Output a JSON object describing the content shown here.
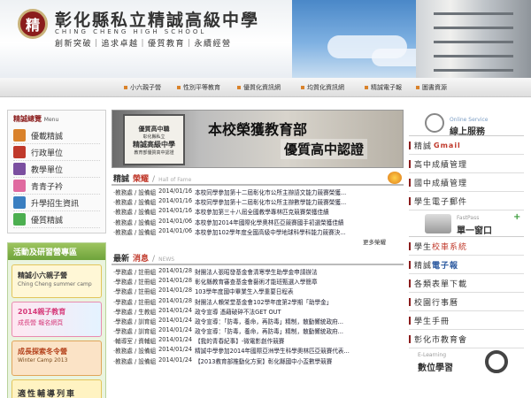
{
  "header": {
    "logo_char": "精",
    "school_name": "彰化縣私立精誠高級中學",
    "school_en": "CHING CHENG HIGH SCHOOL",
    "motto": "創新突破｜追求卓越｜優質教育｜永續經營"
  },
  "nav": [
    {
      "label": "小六親子營"
    },
    {
      "label": "性別平等教育"
    },
    {
      "label": "優質化資訊網"
    },
    {
      "label": "均質化資訊網"
    },
    {
      "label": "精誠電子報"
    },
    {
      "label": "圖書資源"
    }
  ],
  "sidebar": {
    "title": "精誠總覽",
    "title_en": "Menu",
    "items": [
      {
        "label": "優載精誠",
        "color": "#d9822b"
      },
      {
        "label": "行政單位",
        "color": "#c0392b"
      },
      {
        "label": "教學單位",
        "color": "#7b4fa0"
      },
      {
        "label": "青青子衿",
        "color": "#e06aa0"
      },
      {
        "label": "升學招生資訊",
        "color": "#3a7fc1"
      },
      {
        "label": "優質精誠",
        "color": "#4caf50"
      }
    ]
  },
  "promo": {
    "title": "活動及研習營專區",
    "cards": [
      {
        "title": "精誠小六親子營",
        "sub": "Ching Cheng summer camp"
      },
      {
        "title": "2014親子教育",
        "sub": "成長營 報名網頁"
      },
      {
        "title": "成長探索冬令營",
        "sub": "Winter Camp 2013"
      },
      {
        "title": "適性輔導列車",
        "sub": ""
      }
    ]
  },
  "banner": {
    "badge_line1": "優質高中職",
    "badge_line2": "彰化縣私立",
    "badge_line3": "精誠高級中學",
    "badge_line4": "教育部優質高中認證",
    "headline1": "本校榮獲教育部",
    "headline2": "優質高中認證"
  },
  "honor": {
    "title": "精誠",
    "title_red": "榮耀",
    "title_sep": "/",
    "title_en": "Hall of Fame",
    "rows": [
      {
        "dept": "‧教務處 / 設備組",
        "date": "2014/01/16",
        "text": "本校同學參加第十二屆彰化市公所主辦語文能力競賽榮獲..."
      },
      {
        "dept": "‧教務處 / 設備組",
        "date": "2014/01/16",
        "text": "本校同學參加第十二屆彰化市公所主辦數學能力競賽榮獲..."
      },
      {
        "dept": "‧教務處 / 設備組",
        "date": "2014/01/16",
        "text": "本校參加第三十八屆全國教學專林匹克競賽榮獲佳績"
      },
      {
        "dept": "‧教務處 / 設備組",
        "date": "2014/01/06",
        "text": "本校參加2014年國際化學奧林匹亞競賽國手初選榮獲佳績"
      },
      {
        "dept": "‧教務處 / 設備組",
        "date": "2014/01/06",
        "text": "本校參加102學年度全國高級中學地球科學科能力競賽決..."
      }
    ],
    "more": "更多榮耀"
  },
  "news": {
    "title": "最新",
    "title_red": "消息",
    "title_sep": "/",
    "title_en": "NEWS",
    "rows": [
      {
        "dept": "‧學務處 / 註冊組",
        "date": "2014/01/28",
        "text": "財團法人張昭發基金會清寒學生助學金申請辦法"
      },
      {
        "dept": "‧學務處 / 註冊組",
        "date": "2014/01/28",
        "text": "彰化縣教育審查基金會藝術才能班甄選入學簡章"
      },
      {
        "dept": "‧學務處 / 註冊組",
        "date": "2014/01/28",
        "text": "103學年度國中畢業生入學重要日程表"
      },
      {
        "dept": "‧學務處 / 註冊組",
        "date": "2014/01/28",
        "text": "財團法人賴栄堂基金會102學年度第2學期「助學金」"
      },
      {
        "dept": "‧學務處 / 生教組",
        "date": "2014/01/24",
        "text": "政令宣導 憑藉破碎不法GET OUT"
      },
      {
        "dept": "‧學務處 / 訓育組",
        "date": "2014/01/24",
        "text": "政令宣導：「防毒，養命，再防毒」精制，散動響統政府..."
      },
      {
        "dept": "‧學務處 / 訓育組",
        "date": "2014/01/24",
        "text": "政令宣導：「防毒，養命，再防毒」精制，散動響統政府..."
      },
      {
        "dept": "‧輔導室 / 資輔組",
        "date": "2014/01/24",
        "text": "【我的青春紀事】-微電影創作競賽"
      },
      {
        "dept": "‧教務處 / 設備組",
        "date": "2014/01/24",
        "text": "精誠中學參加2014年國際亞洲學生科學奧林匹亞競賽代表..."
      },
      {
        "dept": "‧教務處 / 設備組",
        "date": "2014/01/24",
        "text": "【2013教育部推動化方案】彰化縣國中小盃數學競賽"
      }
    ]
  },
  "right": {
    "online_en": "Online Service",
    "online_cn": "線上服務",
    "links_a": [
      {
        "label": "精誠",
        "extra": "Gmail",
        "type": "gmail"
      },
      {
        "label": "高中成績管理",
        "extra": "",
        "type": "plain"
      },
      {
        "label": "國中成績管理",
        "extra": "",
        "type": "plain"
      },
      {
        "label": "學生電子郵件",
        "extra": "",
        "type": "plain"
      }
    ],
    "window_en": "FastPass",
    "window_cn": "單一窗口",
    "links_b": [
      {
        "label": "學生",
        "extra": "校車系統",
        "type": "red"
      },
      {
        "label": "精誠",
        "extra": "電子報",
        "type": "blue"
      },
      {
        "label": "各類表單下載",
        "extra": "",
        "type": "plain"
      },
      {
        "label": "校園行事曆",
        "extra": "",
        "type": "plain"
      },
      {
        "label": "學生手冊",
        "extra": "",
        "type": "plain"
      },
      {
        "label": "彰化市教育會",
        "extra": "",
        "type": "plain"
      }
    ],
    "elearn_en": "E-Learning",
    "elearn_cn": "數位學習"
  }
}
